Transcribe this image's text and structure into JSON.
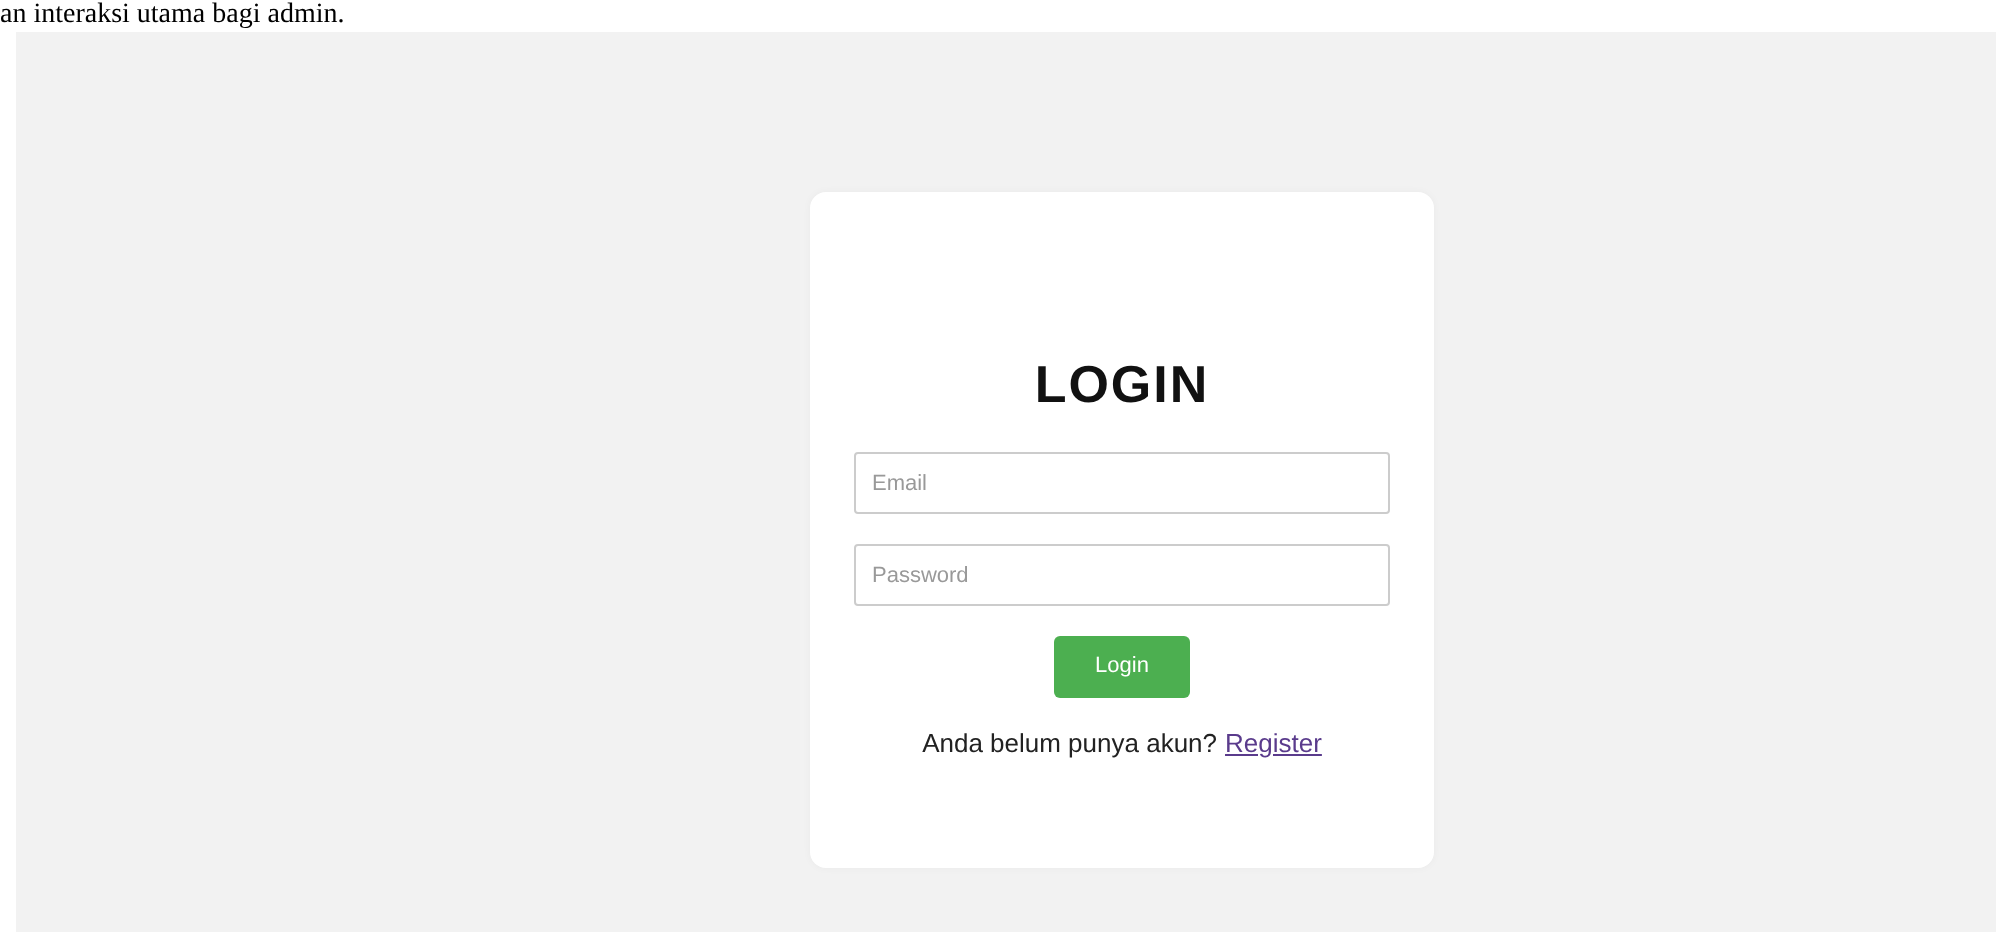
{
  "caption": "an interaksi utama bagi admin.",
  "login_card": {
    "title": "LOGIN",
    "fields": [
      {
        "placeholder": "Email"
      },
      {
        "placeholder": "Password"
      }
    ],
    "button": "Login",
    "prompt": "Anda belum punya akun?",
    "link": "Register"
  }
}
